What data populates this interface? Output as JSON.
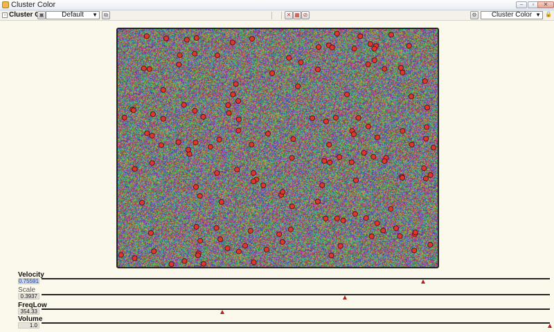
{
  "window": {
    "title": "Cluster Color",
    "controls": [
      "minimize-icon",
      "maximize-icon",
      "close-icon"
    ]
  },
  "toolbar": {
    "panel_name": "Cluster Clr",
    "preset_value": "Default",
    "right_dropdown_value": "Cluster Color",
    "icons": [
      "collapse-icon",
      "camera-icon",
      "copy-icon",
      "x-icon",
      "grid-icon",
      "no-icon",
      "gear-icon",
      "lock-icon"
    ]
  },
  "canvas": {
    "border_color": "#222222",
    "dot_color": "#e0342e"
  },
  "parameters": [
    {
      "label": "Velocity",
      "value": "0.75591",
      "fraction": 0.75
    },
    {
      "label": "Scale",
      "value": "0.3937",
      "fraction": 0.597
    },
    {
      "label": "FreqLow",
      "value": "354.33",
      "fraction": 0.355
    },
    {
      "label": "Volume",
      "value": "1.0",
      "fraction": 1.0
    }
  ]
}
